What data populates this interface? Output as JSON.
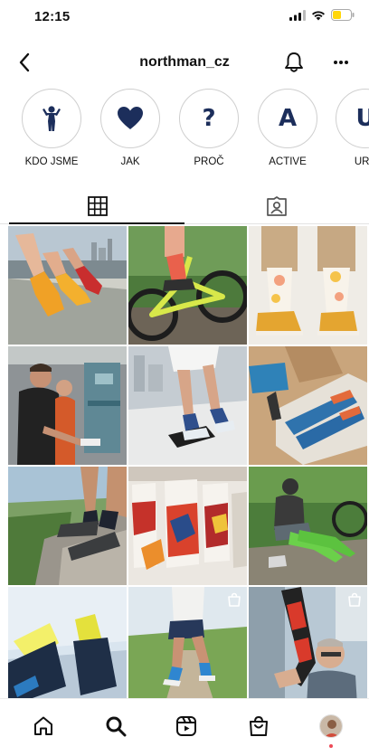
{
  "status": {
    "time": "12:15",
    "battery_color": "#ffd60a"
  },
  "header": {
    "username": "northman_cz",
    "back_icon": "chevron-left-icon",
    "bell_icon": "bell-icon",
    "more_icon": "more-icon"
  },
  "highlights": [
    {
      "label": "KDO JSME",
      "icon": "person-icon",
      "text": ""
    },
    {
      "label": "JAK",
      "icon": "heart-icon",
      "text": ""
    },
    {
      "label": "PROČ",
      "icon": "question-icon",
      "text": "?"
    },
    {
      "label": "ACTIVE",
      "icon": "letter-a-icon",
      "text": "A"
    },
    {
      "label": "URE",
      "icon": "letter-u-icon",
      "text": "U"
    }
  ],
  "tabs": [
    {
      "name": "grid",
      "icon": "grid-icon",
      "active": true
    },
    {
      "name": "tagged",
      "icon": "tagged-person-icon",
      "active": false
    }
  ],
  "posts": [
    {
      "subject": "orange and red socks on feet, city background",
      "shop": false
    },
    {
      "subject": "rider foot with orange socks on mountain bike",
      "shop": false
    },
    {
      "subject": "feet with patterned socks and yellow shoes",
      "shop": false
    },
    {
      "subject": "two people at textile machine in factory",
      "shop": false
    },
    {
      "subject": "skateboarder in blue socks on board",
      "shop": false
    },
    {
      "subject": "stacks of blue and orange socks on box",
      "shop": false
    },
    {
      "subject": "legs in black socks and boots on rock",
      "shop": false
    },
    {
      "subject": "packaged colorful socks on display",
      "shop": false
    },
    {
      "subject": "cyclist sitting with green socks on grass",
      "shop": false
    },
    {
      "subject": "skiing legs with yellow ski boots",
      "shop": false
    },
    {
      "subject": "runner on trail wearing blue socks",
      "shop": true
    },
    {
      "subject": "man holding red and black sock",
      "shop": true
    }
  ],
  "nav": [
    {
      "name": "home",
      "icon": "home-icon"
    },
    {
      "name": "search",
      "icon": "search-icon",
      "active": true
    },
    {
      "name": "reels",
      "icon": "reels-icon"
    },
    {
      "name": "shop",
      "icon": "shop-icon"
    },
    {
      "name": "profile",
      "icon": "profile-avatar-icon"
    }
  ],
  "colors": {
    "accent_navy": "#1c2e5b",
    "notification_dot": "#ed4956",
    "text": "#111111",
    "border": "#cfcfcf"
  }
}
